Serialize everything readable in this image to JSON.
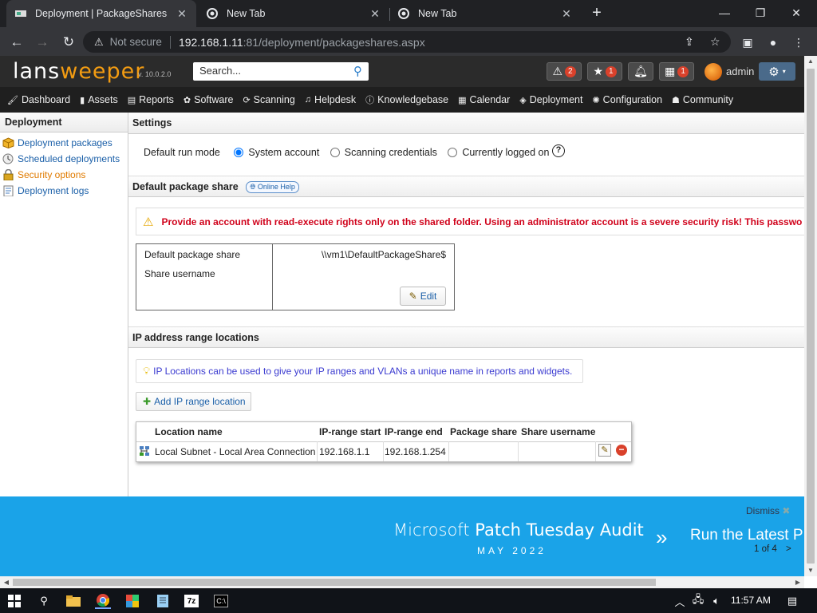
{
  "browser": {
    "tabs": [
      {
        "title": "Deployment | PackageShares",
        "active": true
      },
      {
        "title": "New Tab",
        "active": false
      },
      {
        "title": "New Tab",
        "active": false
      }
    ],
    "new_tab_symbol": "+",
    "security_label": "Not secure",
    "url_host": "192.168.1.11",
    "url_rest": ":81/deployment/packageshares.aspx"
  },
  "header": {
    "logo_part1": "lans",
    "logo_part2": "weeper",
    "version": "v. 10.0.2.0",
    "search_placeholder": "Search...",
    "alerts_count": "2",
    "favorites_count": "1",
    "calendar_count": "1",
    "username": "admin"
  },
  "nav": [
    {
      "label": "Dashboard",
      "icon": "dashboard-icon"
    },
    {
      "label": "Assets",
      "icon": "assets-icon"
    },
    {
      "label": "Reports",
      "icon": "reports-icon"
    },
    {
      "label": "Software",
      "icon": "software-icon"
    },
    {
      "label": "Scanning",
      "icon": "scanning-icon"
    },
    {
      "label": "Helpdesk",
      "icon": "headset-icon"
    },
    {
      "label": "Knowledgebase",
      "icon": "info-icon"
    },
    {
      "label": "Calendar",
      "icon": "calendar-icon"
    },
    {
      "label": "Deployment",
      "icon": "box-icon"
    },
    {
      "label": "Configuration",
      "icon": "gear-icon"
    },
    {
      "label": "Community",
      "icon": "community-icon"
    }
  ],
  "sidebar": {
    "title": "Deployment",
    "items": [
      {
        "label": "Deployment packages",
        "active": false
      },
      {
        "label": "Scheduled deployments",
        "active": false
      },
      {
        "label": "Security options",
        "active": true
      },
      {
        "label": "Deployment logs",
        "active": false
      }
    ]
  },
  "settings": {
    "title": "Settings",
    "run_mode_label": "Default run mode",
    "options": [
      "System account",
      "Scanning credentials",
      "Currently logged on"
    ],
    "selected": "System account",
    "help_symbol": "?"
  },
  "package_share": {
    "title": "Default package share",
    "online_help": "Online Help",
    "warning": "Provide an account with read-execute rights only on the shared folder. Using an administrator account is a severe security risk! This passwo",
    "share_label": "Default package share",
    "share_value": "\\\\vm1\\DefaultPackageShare$",
    "username_label": "Share username",
    "username_value": "",
    "edit_label": "Edit"
  },
  "ip_locations": {
    "title": "IP address range locations",
    "info": "IP Locations can be used to give your IP ranges and VLANs a unique name in reports and widgets.",
    "add_label": "Add IP range location",
    "columns": [
      "Location name",
      "IP-range start",
      "IP-range end",
      "Package share",
      "Share username"
    ],
    "rows": [
      {
        "name": "Local Subnet - Local Area Connection",
        "start": "192.168.1.1",
        "end": "192.168.1.254",
        "share": "",
        "username": ""
      }
    ]
  },
  "banner": {
    "title_light": "Microsoft ",
    "title_bold": "Patch Tuesday Audit",
    "subtitle": "MAY 2022",
    "next_title": "Run the Latest P",
    "dismiss": "Dismiss",
    "pager": "1 of 4",
    "pager_arrow": ">"
  },
  "taskbar": {
    "time": "11:57 AM"
  },
  "colors": {
    "accent_orange": "#f39c12",
    "link_blue": "#1a5fa8",
    "warning_red": "#d0021b",
    "banner_blue": "#1aa3e8",
    "badge_red": "#d9412b"
  }
}
